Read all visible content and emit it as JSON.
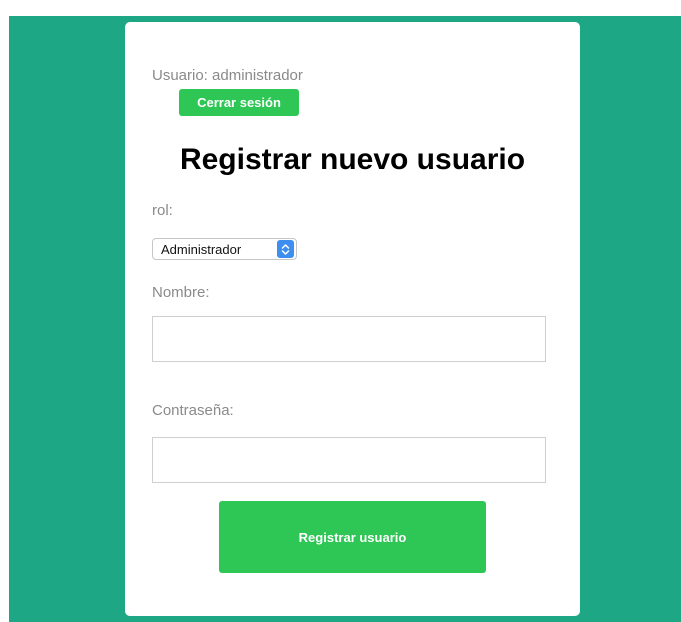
{
  "colors": {
    "background": "#1ea784",
    "card": "#ffffff",
    "accent_button": "#2ec654",
    "select_arrow": "#3d8ef0",
    "label_text": "#8a8a8a"
  },
  "session": {
    "user_text": "Usuario: administrador",
    "logout_label": "Cerrar sesión"
  },
  "form": {
    "title": "Registrar nuevo usuario",
    "role_label": "rol:",
    "role_selected": "Administrador",
    "role_arrow_icon": "up-down-chevron-icon",
    "name_label": "Nombre:",
    "name_value": "",
    "password_label": "Contraseña:",
    "password_value": "",
    "submit_label": "Registrar usuario"
  }
}
